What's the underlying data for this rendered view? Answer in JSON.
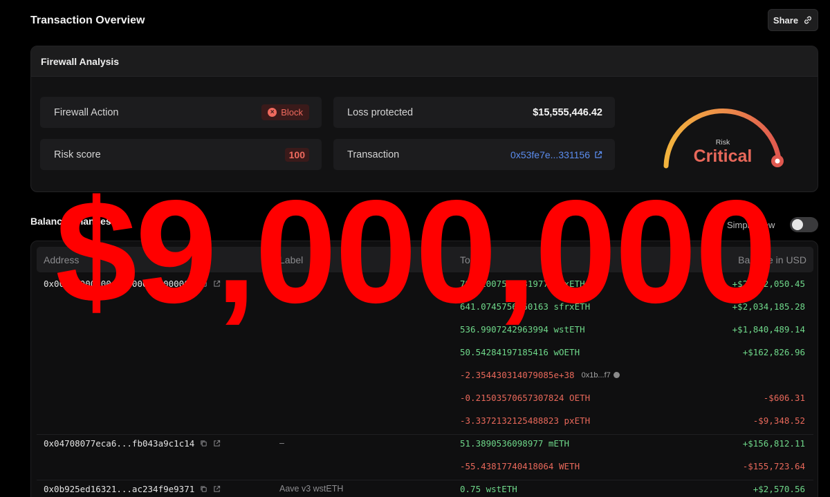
{
  "header": {
    "title": "Transaction Overview",
    "share_label": "Share"
  },
  "firewall": {
    "title": "Firewall Analysis",
    "action_label": "Firewall Action",
    "action_value": "Block",
    "loss_label": "Loss protected",
    "loss_value": "$15,555,446.42",
    "risk_label": "Risk score",
    "risk_value": "100",
    "tx_label": "Transaction",
    "tx_value": "0x53fe7e...331156",
    "gauge_caption": "Risk",
    "gauge_value": "Critical",
    "gauge_level": 1.0
  },
  "balance": {
    "title": "Balance Changes",
    "simple_view_label": "Simple view",
    "columns": [
      "Address",
      "Label",
      "Token",
      "Balance in USD"
    ],
    "groups": [
      {
        "address": "0x00000000000...0000000000000",
        "label": "",
        "rows": [
          {
            "token": "798.1007564331977 apxETH",
            "usd": "+$2,462,050.45",
            "sign": "pos"
          },
          {
            "token": "641.0745756960163 sfrxETH",
            "usd": "+$2,034,185.28",
            "sign": "pos"
          },
          {
            "token": "536.9907242963994 wstETH",
            "usd": "+$1,840,489.14",
            "sign": "pos"
          },
          {
            "token": "50.54284197185416 wOETH",
            "usd": "+$162,826.96",
            "sign": "pos"
          },
          {
            "token": "-2.354430314079085e+38",
            "extra": "0x1b...f7",
            "usd": "",
            "sign": "neg"
          },
          {
            "token": "-0.21503570657307824 OETH",
            "usd": "-$606.31",
            "sign": "neg"
          },
          {
            "token": "-3.3372132125488823 pxETH",
            "usd": "-$9,348.52",
            "sign": "neg"
          }
        ]
      },
      {
        "address": "0x04708077eca6...fb043a9c1c14",
        "label": "–",
        "rows": [
          {
            "token": "51.3890536098977 mETH",
            "usd": "+$156,812.11",
            "sign": "pos"
          },
          {
            "token": "-55.43817740418064 WETH",
            "usd": "-$155,723.64",
            "sign": "neg"
          }
        ]
      },
      {
        "address": "0x0b925ed16321...ac234f9e9371",
        "label": "Aave v3 wstETH",
        "rows": [
          {
            "token": "0.75 wstETH",
            "usd": "+$2,570.56",
            "sign": "pos"
          }
        ]
      }
    ]
  },
  "overlay": {
    "text": "$9,000,000"
  },
  "colors": {
    "positive": "#6fd88a",
    "negative": "#e8685a",
    "link": "#5b8def",
    "overlay": "#ff0000"
  },
  "icons": [
    "link-icon",
    "x-circle-icon",
    "external-link-icon",
    "copy-icon",
    "info-icon"
  ]
}
